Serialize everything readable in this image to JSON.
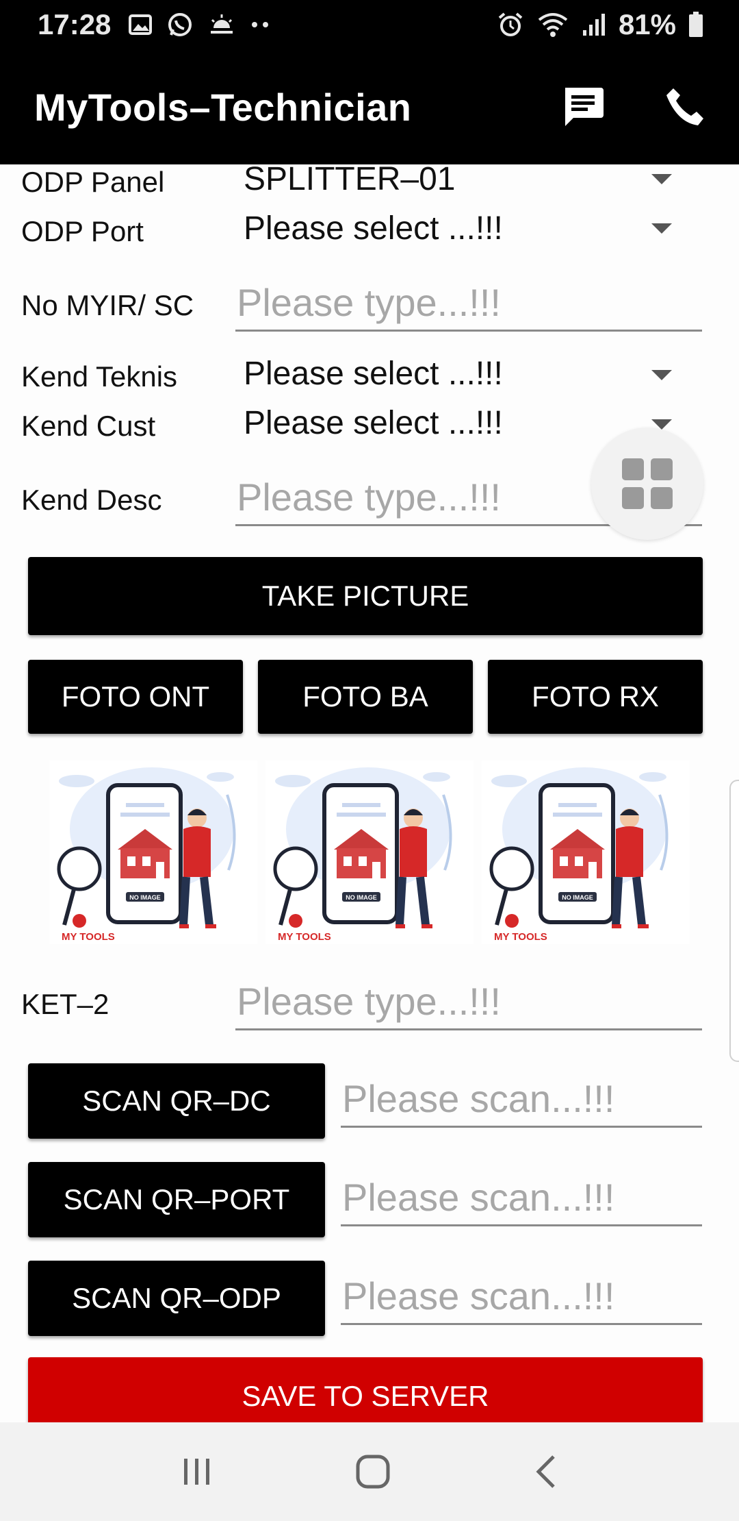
{
  "status_bar": {
    "time": "17:28",
    "battery": "81%",
    "icons": [
      "gallery-icon",
      "whatsapp-icon",
      "weather-icon",
      "more-dots-icon",
      "alarm-icon",
      "wifi-icon",
      "signal-icon",
      "battery-icon"
    ]
  },
  "app_bar": {
    "title": "MyTools–Technician",
    "actions": [
      "message-icon",
      "phone-icon"
    ]
  },
  "form": {
    "odp_panel": {
      "label": "ODP Panel",
      "value": "SPLITTER–01"
    },
    "odp_port": {
      "label": "ODP Port",
      "value": "Please select ...!!!"
    },
    "no_myir": {
      "label": "No MYIR/ SC",
      "placeholder": "Please type...!!!"
    },
    "kend_teknis": {
      "label": "Kend Teknis",
      "value": "Please select ...!!!"
    },
    "kend_cust": {
      "label": "Kend Cust",
      "value": "Please select ...!!!"
    },
    "kend_desc": {
      "label": "Kend Desc",
      "placeholder": "Please type...!!!"
    },
    "ket2": {
      "label": "KET–2",
      "placeholder": "Please type...!!!"
    }
  },
  "buttons": {
    "take_picture": "TAKE PICTURE",
    "foto_ont": "FOTO ONT",
    "foto_ba": "FOTO BA",
    "foto_rx": "FOTO RX",
    "scan_dc": "SCAN QR–DC",
    "scan_port": "SCAN QR–PORT",
    "scan_odp": "SCAN QR–ODP",
    "save": "SAVE TO SERVER"
  },
  "scan_fields": {
    "dc_placeholder": "Please scan...!!!",
    "port_placeholder": "Please scan...!!!",
    "odp_placeholder": "Please scan...!!!"
  },
  "photos": {
    "placeholder_text": "NO IMAGE",
    "brand": "MY TOOLS"
  },
  "colors": {
    "app_bar": "#000000",
    "button": "#000000",
    "save_button": "#d00000",
    "accent_red": "#d62828"
  }
}
